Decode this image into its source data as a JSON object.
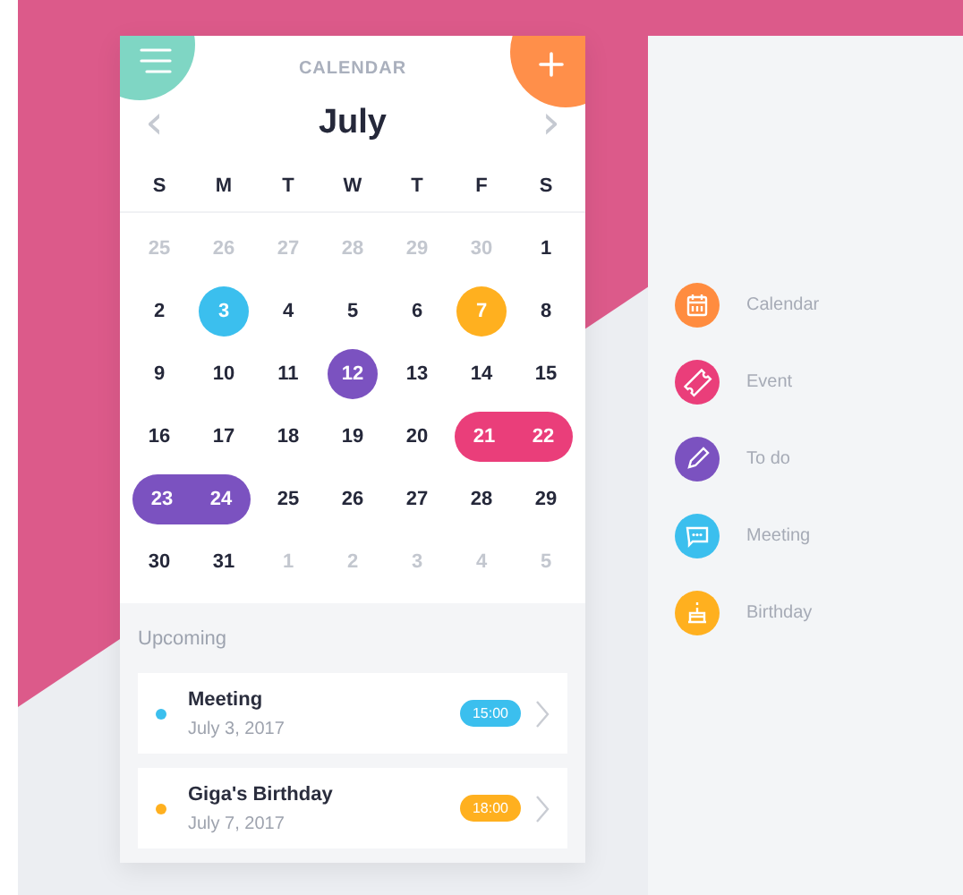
{
  "calendar": {
    "title": "CALENDAR",
    "month": "July",
    "prev": "‹",
    "next": "›",
    "weekdays": [
      "S",
      "M",
      "T",
      "W",
      "T",
      "F",
      "S"
    ],
    "days": [
      {
        "label": "25",
        "muted": true,
        "kind": "plain"
      },
      {
        "label": "26",
        "muted": true,
        "kind": "plain"
      },
      {
        "label": "27",
        "muted": true,
        "kind": "plain"
      },
      {
        "label": "28",
        "muted": true,
        "kind": "plain"
      },
      {
        "label": "29",
        "muted": true,
        "kind": "plain"
      },
      {
        "label": "30",
        "muted": true,
        "kind": "plain"
      },
      {
        "label": "1",
        "muted": false,
        "kind": "plain"
      },
      {
        "label": "2",
        "muted": false,
        "kind": "plain"
      },
      {
        "label": "3",
        "muted": false,
        "kind": "circle",
        "color": "#3bbfee"
      },
      {
        "label": "4",
        "muted": false,
        "kind": "plain"
      },
      {
        "label": "5",
        "muted": false,
        "kind": "plain"
      },
      {
        "label": "6",
        "muted": false,
        "kind": "plain"
      },
      {
        "label": "7",
        "muted": false,
        "kind": "circle",
        "color": "#ffb01f"
      },
      {
        "label": "8",
        "muted": false,
        "kind": "plain"
      },
      {
        "label": "9",
        "muted": false,
        "kind": "plain"
      },
      {
        "label": "10",
        "muted": false,
        "kind": "plain"
      },
      {
        "label": "11",
        "muted": false,
        "kind": "plain"
      },
      {
        "label": "12",
        "muted": false,
        "kind": "circle",
        "color": "#7b52c0"
      },
      {
        "label": "13",
        "muted": false,
        "kind": "plain"
      },
      {
        "label": "14",
        "muted": false,
        "kind": "plain"
      },
      {
        "label": "15",
        "muted": false,
        "kind": "plain"
      },
      {
        "label": "16",
        "muted": false,
        "kind": "plain"
      },
      {
        "label": "17",
        "muted": false,
        "kind": "plain"
      },
      {
        "label": "18",
        "muted": false,
        "kind": "plain"
      },
      {
        "label": "19",
        "muted": false,
        "kind": "plain"
      },
      {
        "label": "20",
        "muted": false,
        "kind": "plain"
      },
      {
        "label": "21",
        "muted": false,
        "kind": "range-start",
        "color": "#ea3e7a"
      },
      {
        "label": "22",
        "muted": false,
        "kind": "range-end",
        "color": "#ea3e7a"
      },
      {
        "label": "23",
        "muted": false,
        "kind": "range-start",
        "color": "#7b52c0"
      },
      {
        "label": "24",
        "muted": false,
        "kind": "range-end",
        "color": "#7b52c0"
      },
      {
        "label": "25",
        "muted": false,
        "kind": "plain"
      },
      {
        "label": "26",
        "muted": false,
        "kind": "plain"
      },
      {
        "label": "27",
        "muted": false,
        "kind": "plain"
      },
      {
        "label": "28",
        "muted": false,
        "kind": "plain"
      },
      {
        "label": "29",
        "muted": false,
        "kind": "plain"
      },
      {
        "label": "30",
        "muted": false,
        "kind": "plain"
      },
      {
        "label": "31",
        "muted": false,
        "kind": "plain"
      },
      {
        "label": "1",
        "muted": true,
        "kind": "plain"
      },
      {
        "label": "2",
        "muted": true,
        "kind": "plain"
      },
      {
        "label": "3",
        "muted": true,
        "kind": "plain"
      },
      {
        "label": "4",
        "muted": true,
        "kind": "plain"
      },
      {
        "label": "5",
        "muted": true,
        "kind": "plain"
      }
    ]
  },
  "upcoming": {
    "title": "Upcoming",
    "events": [
      {
        "title": "Meeting",
        "date": "July 3, 2017",
        "time": "15:00",
        "color": "#3bbfee"
      },
      {
        "title": "Giga's Birthday",
        "date": "July 7, 2017",
        "time": "18:00",
        "color": "#ffb01f"
      }
    ]
  },
  "menu": {
    "items": [
      {
        "label": "Calendar",
        "color": "#ff8c3f"
      },
      {
        "label": "Event",
        "color": "#ea3e7a"
      },
      {
        "label": "To do",
        "color": "#7b52c0"
      },
      {
        "label": "Meeting",
        "color": "#3bbfee"
      },
      {
        "label": "Birthday",
        "color": "#ffb01f"
      }
    ]
  }
}
